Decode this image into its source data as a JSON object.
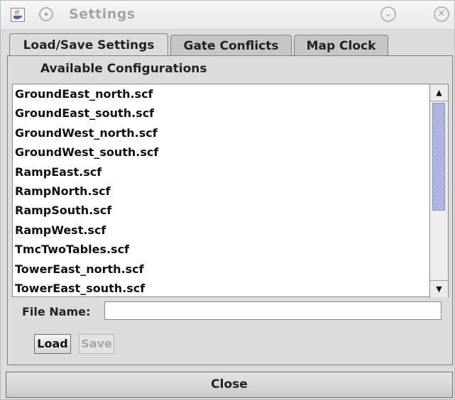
{
  "window": {
    "title": "Settings"
  },
  "tabs": [
    {
      "label": "Load/Save Settings",
      "active": true
    },
    {
      "label": "Gate Conflicts",
      "active": false
    },
    {
      "label": "Map Clock",
      "active": false
    }
  ],
  "load_save": {
    "section_label": "Available Configurations",
    "configurations": [
      "GroundEast_north.scf",
      "GroundEast_south.scf",
      "GroundWest_north.scf",
      "GroundWest_south.scf",
      "RampEast.scf",
      "RampNorth.scf",
      "RampSouth.scf",
      "RampWest.scf",
      "TmcTwoTables.scf",
      "TowerEast_north.scf",
      "TowerEast_south.scf"
    ],
    "file_name_label": "File Name:",
    "file_name_value": "",
    "load_label": "Load",
    "save_label": "Save"
  },
  "footer": {
    "close_label": "Close"
  },
  "icons": {
    "app": "java-app-icon",
    "menu": "window-menu-icon",
    "minimize": "minimize-icon",
    "close": "window-close-icon",
    "scroll_up": "scroll-up-arrow-icon",
    "scroll_down": "scroll-down-arrow-icon"
  },
  "colors": {
    "scroll_thumb": "#b9bde6",
    "window_bg": "#dcdcdc"
  }
}
